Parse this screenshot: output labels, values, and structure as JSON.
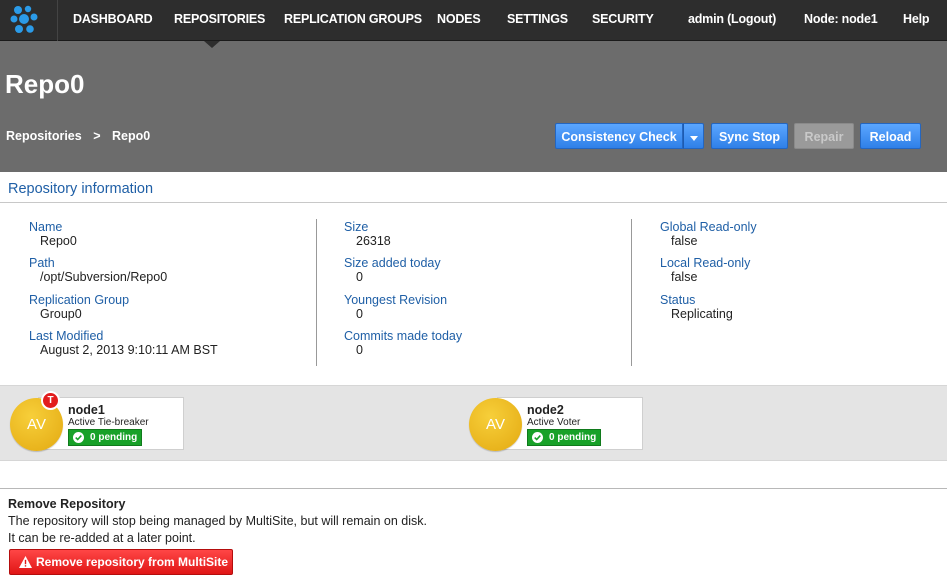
{
  "nav": {
    "items": [
      "DASHBOARD",
      "REPOSITORIES",
      "REPLICATION GROUPS",
      "NODES",
      "SETTINGS",
      "SECURITY"
    ],
    "active": "REPOSITORIES",
    "user": "admin (Logout)",
    "node": "Node: node1",
    "help": "Help",
    "logo_icon": "cluster-dots-logo"
  },
  "header": {
    "title": "Repo0",
    "breadcrumb": [
      "Repositories",
      ">",
      "Repo0"
    ],
    "buttons": {
      "consistency_check": "Consistency Check",
      "sync_stop": "Sync Stop",
      "repair": "Repair",
      "reload": "Reload"
    }
  },
  "info": {
    "heading": "Repository information",
    "columns": [
      [
        {
          "label": "Name",
          "value": "Repo0"
        },
        {
          "label": "Path",
          "value": "/opt/Subversion/Repo0"
        },
        {
          "label": "Replication Group",
          "value": "Group0"
        },
        {
          "label": "Last Modified",
          "value": "August 2, 2013 9:10:11 AM BST"
        }
      ],
      [
        {
          "label": "Size",
          "value": "26318"
        },
        {
          "label": "Size added today",
          "value": "0"
        },
        {
          "label": "Youngest Revision",
          "value": "0"
        },
        {
          "label": "Commits made today",
          "value": "0"
        }
      ],
      [
        {
          "label": "Global Read-only",
          "value": "false"
        },
        {
          "label": "Local Read-only",
          "value": "false"
        },
        {
          "label": "Status",
          "value": "Replicating"
        }
      ]
    ]
  },
  "nodes": [
    {
      "avatar": "AV",
      "badge": "T",
      "name": "node1",
      "role": "Active Tie-breaker",
      "pending": "0 pending"
    },
    {
      "avatar": "AV",
      "badge": "",
      "name": "node2",
      "role": "Active Voter",
      "pending": "0 pending"
    }
  ],
  "remove": {
    "title": "Remove Repository",
    "line1": "The repository will stop being managed by MultiSite, but will remain on disk.",
    "line2": "It can be re-added at a later point.",
    "button": "Remove repository from MultiSite"
  },
  "colors": {
    "nav_bg": "#2d2d2d",
    "header_bg": "#6c6c6c",
    "label_blue": "#1f5fa6",
    "button_blue": "#2f80e8",
    "pending_green": "#18a128",
    "danger_red": "#e01616",
    "avatar_yellow": "#f2c22a"
  }
}
